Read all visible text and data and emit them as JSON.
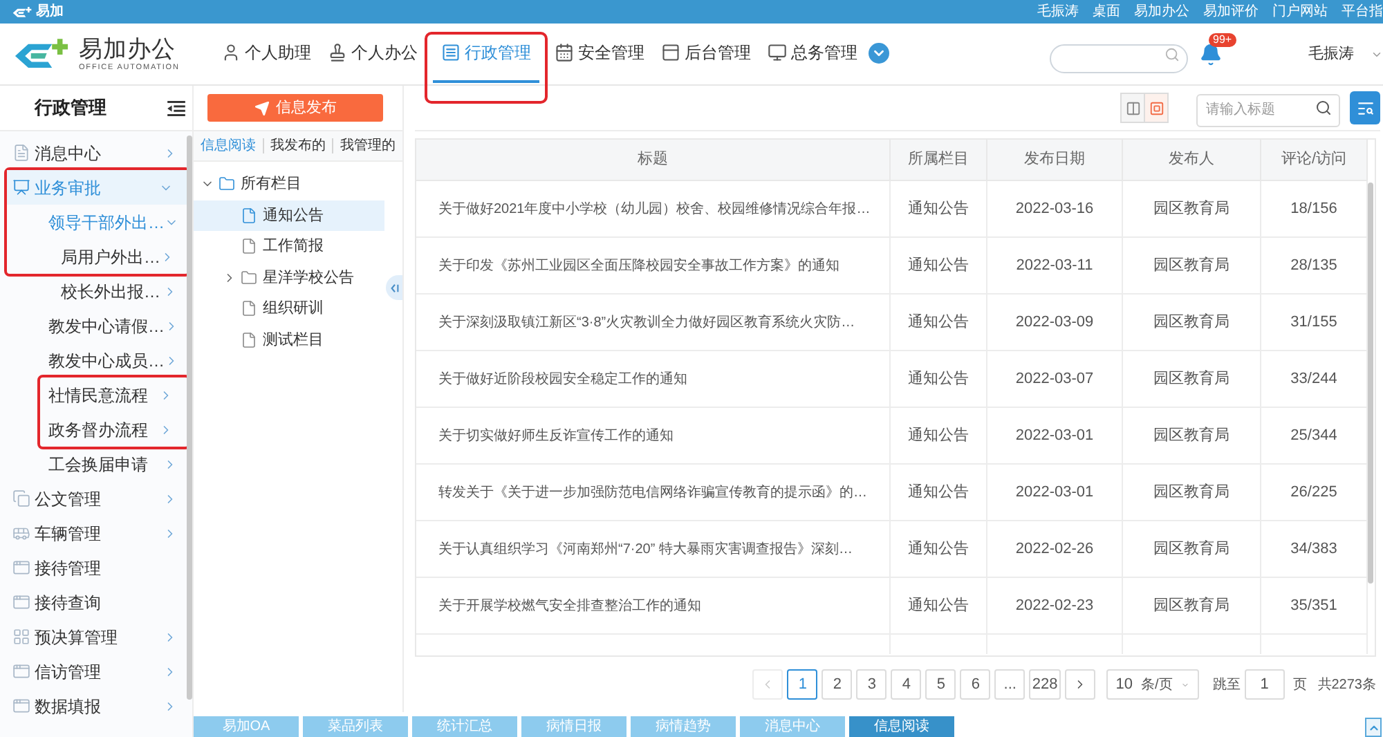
{
  "top_bar": {
    "brand": "易加",
    "links": [
      "毛振涛",
      "桌面",
      "易加办公",
      "易加评价",
      "门户网站",
      "平台指"
    ]
  },
  "header": {
    "logo": {
      "title": "易加办公",
      "subtitle": "OFFICE AUTOMATION"
    },
    "nav_tabs": [
      {
        "label": "个人助理",
        "selected": false,
        "outlined": false
      },
      {
        "label": "个人办公",
        "selected": false,
        "outlined": false
      },
      {
        "label": "行政管理",
        "selected": true,
        "outlined": true
      },
      {
        "label": "安全管理",
        "selected": false,
        "outlined": false
      },
      {
        "label": "后台管理",
        "selected": false,
        "outlined": false
      },
      {
        "label": "总务管理",
        "selected": false,
        "outlined": false
      }
    ],
    "notifications": {
      "badge": "99+"
    },
    "user": "毛振涛"
  },
  "sidebar": {
    "title": "行政管理",
    "items": [
      {
        "label": "消息中心",
        "kind": "menu",
        "expanded": false,
        "selected": false,
        "outlined": false
      },
      {
        "label": "业务审批",
        "kind": "menu",
        "expanded": true,
        "selected": true,
        "outlined": true,
        "children": [
          {
            "label": "领导干部外出…",
            "kind": "menu",
            "expanded": true,
            "selected": false,
            "outlined": true,
            "children": [
              {
                "label": "局用户外出…",
                "kind": "menu",
                "expanded": false,
                "selected": false,
                "outlined": true
              },
              {
                "label": "校长外出报…",
                "kind": "menu",
                "expanded": false,
                "selected": false,
                "outlined": false
              }
            ]
          },
          {
            "label": "教发中心请假…",
            "kind": "menu",
            "expanded": false,
            "selected": false,
            "outlined": false
          },
          {
            "label": "教发中心成员…",
            "kind": "menu",
            "expanded": false,
            "selected": false,
            "outlined": false
          },
          {
            "label": "社情民意流程",
            "kind": "menu",
            "expanded": false,
            "selected": false,
            "outlined": true
          },
          {
            "label": "政务督办流程",
            "kind": "menu",
            "expanded": false,
            "selected": false,
            "outlined": true
          },
          {
            "label": "工会换届申请",
            "kind": "menu",
            "expanded": false,
            "selected": false,
            "outlined": false
          }
        ]
      },
      {
        "label": "公文管理",
        "kind": "menu",
        "expanded": false,
        "selected": false,
        "outlined": false
      },
      {
        "label": "车辆管理",
        "kind": "menu",
        "expanded": false,
        "selected": false,
        "outlined": false
      },
      {
        "label": "接待管理",
        "kind": "page",
        "expanded": false,
        "selected": false,
        "outlined": false
      },
      {
        "label": "接待查询",
        "kind": "page",
        "expanded": false,
        "selected": false,
        "outlined": false
      },
      {
        "label": "预决算管理",
        "kind": "menu",
        "expanded": false,
        "selected": false,
        "outlined": false
      },
      {
        "label": "信访管理",
        "kind": "menu",
        "expanded": false,
        "selected": false,
        "outlined": false
      },
      {
        "label": "数据填报",
        "kind": "menu",
        "expanded": false,
        "selected": false,
        "outlined": false
      }
    ]
  },
  "publish_button": "信息发布",
  "column_panel": {
    "tabs": [
      {
        "label": "信息阅读",
        "selected": true
      },
      {
        "label": "我发布的",
        "selected": false
      },
      {
        "label": "我管理的",
        "selected": false
      }
    ],
    "tree": [
      {
        "label": "所有栏目",
        "kind": "folder",
        "expanded": true,
        "selected": false,
        "children": [
          {
            "label": "通知公告",
            "kind": "file",
            "selected": true
          },
          {
            "label": "工作简报",
            "kind": "file",
            "selected": false
          },
          {
            "label": "星洋学校公告",
            "kind": "folder",
            "expanded": false,
            "selected": false
          },
          {
            "label": "组织研训",
            "kind": "file",
            "selected": false
          },
          {
            "label": "测试栏目",
            "kind": "file",
            "selected": false
          }
        ]
      }
    ]
  },
  "toolbar": {
    "view_modes": [
      {
        "selected": false
      },
      {
        "selected": true
      }
    ],
    "search": {
      "placeholder": "请输入标题"
    }
  },
  "table": {
    "columns": [
      "标题",
      "所属栏目",
      "发布日期",
      "发布人",
      "评论/访问"
    ],
    "rows": [
      [
        "关于做好2021年度中小学校（幼儿园）校舍、校园维修情况综合年报…",
        "通知公告",
        "2022-03-16",
        "园区教育局",
        "18/156"
      ],
      [
        "关于印发《苏州工业园区全面压降校园安全事故工作方案》的通知",
        "通知公告",
        "2022-03-11",
        "园区教育局",
        "28/135"
      ],
      [
        "关于深刻汲取镇江新区“3·8”火灾教训全力做好园区教育系统火灾防…",
        "通知公告",
        "2022-03-09",
        "园区教育局",
        "31/155"
      ],
      [
        "关于做好近阶段校园安全稳定工作的通知",
        "通知公告",
        "2022-03-07",
        "园区教育局",
        "33/244"
      ],
      [
        "关于切实做好师生反诈宣传工作的通知",
        "通知公告",
        "2022-03-01",
        "园区教育局",
        "25/344"
      ],
      [
        "转发关于《关于进一步加强防范电信网络诈骗宣传教育的提示函》的…",
        "通知公告",
        "2022-03-01",
        "园区教育局",
        "26/225"
      ],
      [
        "关于认真组织学习《河南郑州“7·20” 特大暴雨灾害调查报告》深刻…",
        "通知公告",
        "2022-02-26",
        "园区教育局",
        "34/383"
      ],
      [
        "关于开展学校燃气安全排查整治工作的通知",
        "通知公告",
        "2022-02-23",
        "园区教育局",
        "35/351"
      ]
    ]
  },
  "pagination": {
    "prev": {
      "disabled": true
    },
    "pages": [
      {
        "label": "1",
        "selected": true
      },
      {
        "label": "2",
        "selected": false
      },
      {
        "label": "3",
        "selected": false
      },
      {
        "label": "4",
        "selected": false
      },
      {
        "label": "5",
        "selected": false
      },
      {
        "label": "6",
        "selected": false
      },
      {
        "label": "...",
        "selected": false
      },
      {
        "label": "228",
        "selected": false
      }
    ],
    "next": {
      "disabled": false
    },
    "page_size": {
      "value": "10",
      "unit": "条/页"
    },
    "jump": {
      "label": "跳至",
      "value": "1",
      "unit": "页"
    },
    "total": "共2273条"
  },
  "taskbar": {
    "tabs": [
      {
        "label": "易加OA",
        "selected": false
      },
      {
        "label": "菜品列表",
        "selected": false
      },
      {
        "label": "统计汇总",
        "selected": false
      },
      {
        "label": "病情日报",
        "selected": false
      },
      {
        "label": "病情趋势",
        "selected": false
      },
      {
        "label": "消息中心",
        "selected": false
      },
      {
        "label": "信息阅读",
        "selected": true
      }
    ]
  }
}
